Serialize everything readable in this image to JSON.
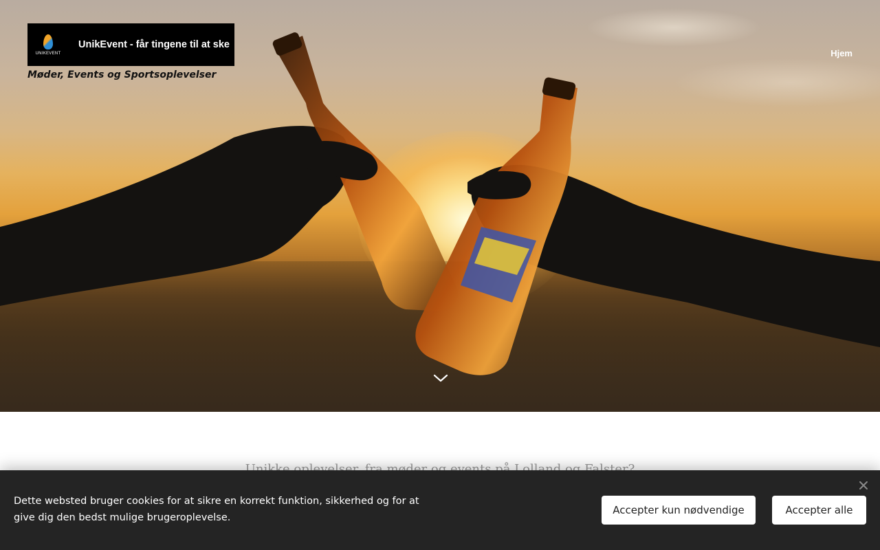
{
  "header": {
    "logo_text": "UnikEvent - får tingene til at ske",
    "logo_wordmark": "UNIKEVENT",
    "tagline": "Møder, Events og Sportsoplevelser",
    "nav": [
      {
        "label": "Hjem"
      }
    ]
  },
  "hero": {
    "image_description_icon": "toasting-bottles-sunset-photo",
    "scroll_icon": "chevron-down-icon"
  },
  "main": {
    "heading": "Unikke oplevelser, fra møder og events på Lolland og Falster?"
  },
  "cookie_banner": {
    "text": "Dette websted bruger cookies for at sikre en korrekt funktion, sikkerhed og for at give dig den bedst mulige brugeroplevelse.",
    "accept_necessary_label": "Accepter kun nødvendige",
    "accept_all_label": "Accepter alle",
    "close_icon": "close-icon"
  },
  "colors": {
    "cookie_bg": "#242424",
    "logo_bg": "#000000",
    "button_bg": "#ffffff",
    "flame_orange": "#f2a52a",
    "flame_blue": "#2f8fd6"
  }
}
